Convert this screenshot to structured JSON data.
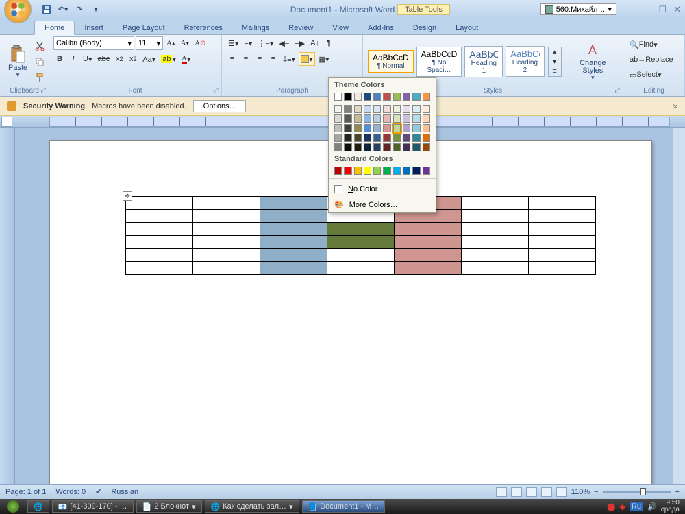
{
  "title": "Document1 - Microsoft Word",
  "table_tools": "Table Tools",
  "user": "560:Михайл…",
  "tabs": {
    "home": "Home",
    "insert": "Insert",
    "pagelayout": "Page Layout",
    "references": "References",
    "mailings": "Mailings",
    "review": "Review",
    "view": "View",
    "addins": "Add-Ins",
    "design": "Design",
    "layout": "Layout"
  },
  "groups": {
    "clipboard": "Clipboard",
    "font": "Font",
    "paragraph": "Paragraph",
    "styles": "Styles",
    "editing": "Editing"
  },
  "clipboard": {
    "paste": "Paste"
  },
  "font": {
    "family": "Calibri (Body)",
    "size": "11"
  },
  "styles": {
    "change": "Change Styles",
    "s1_sample": "AaBbCcDd",
    "s1_name": "¶ Normal",
    "s2_sample": "AaBbCcDd",
    "s2_name": "¶ No Spaci…",
    "s3_sample": "AaBbC",
    "s3_name": "Heading 1",
    "s4_sample": "AaBbCc",
    "s4_name": "Heading 2"
  },
  "editing": {
    "find": "Find",
    "replace": "Replace",
    "select": "Select"
  },
  "security": {
    "title": "Security Warning",
    "msg": "Macros have been disabled.",
    "options": "Options..."
  },
  "popup": {
    "theme": "Theme Colors",
    "standard": "Standard Colors",
    "nocolor": "No Color",
    "more": "More Colors…",
    "theme_row": [
      "#ffffff",
      "#000000",
      "#eeece1",
      "#1f497d",
      "#4f81bd",
      "#c0504d",
      "#9bbb59",
      "#8064a2",
      "#4bacc6",
      "#f79646"
    ],
    "shade1": [
      "#f2f2f2",
      "#808080",
      "#ddd9c3",
      "#c6d9f1",
      "#dce6f2",
      "#f2dcdb",
      "#ebf1dd",
      "#e5e0ec",
      "#dbeef4",
      "#fdeada"
    ],
    "shade2": [
      "#d9d9d9",
      "#595959",
      "#c4bd97",
      "#8eb4e3",
      "#b9cde5",
      "#e6b9b8",
      "#d7e4bd",
      "#ccc1da",
      "#b7dee8",
      "#fcd5b5"
    ],
    "shade3": [
      "#bfbfbf",
      "#404040",
      "#948a54",
      "#558ed5",
      "#95b3d7",
      "#d99694",
      "#c3d69b",
      "#b3a2c7",
      "#93cddd",
      "#fac090"
    ],
    "shade4": [
      "#a6a6a6",
      "#262626",
      "#4a452a",
      "#17375e",
      "#376092",
      "#953735",
      "#77933c",
      "#604a7b",
      "#31859c",
      "#e46c0a"
    ],
    "shade5": [
      "#808080",
      "#0d0d0d",
      "#1e1c11",
      "#10243f",
      "#254061",
      "#632523",
      "#4f6228",
      "#403152",
      "#215968",
      "#984807"
    ],
    "standard_row": [
      "#c00000",
      "#ff0000",
      "#ffc000",
      "#ffff00",
      "#92d050",
      "#00b050",
      "#00b0f0",
      "#0070c0",
      "#002060",
      "#7030a0"
    ]
  },
  "status": {
    "page": "Page: 1 of 1",
    "words": "Words: 0",
    "lang": "Russian",
    "zoom": "110%"
  },
  "taskbar": {
    "t1": "[41-309-170] - …",
    "t2": "2 Блокнот",
    "t3": "Как сделать зал…",
    "t4": "Document1 - M…",
    "lang": "Ru",
    "time": "9:50",
    "day": "среда"
  },
  "table": {
    "rows": 6,
    "cols": 7,
    "blue": "#8faec8",
    "red": "#cf9590",
    "green": "#647a3b",
    "cells": {
      "blue": [
        "0-2",
        "1-2",
        "2-2",
        "3-2",
        "4-2",
        "5-2"
      ],
      "red": [
        "0-4",
        "1-4",
        "2-4",
        "3-4",
        "4-4",
        "5-4"
      ],
      "green": [
        "2-3",
        "3-3"
      ]
    }
  }
}
